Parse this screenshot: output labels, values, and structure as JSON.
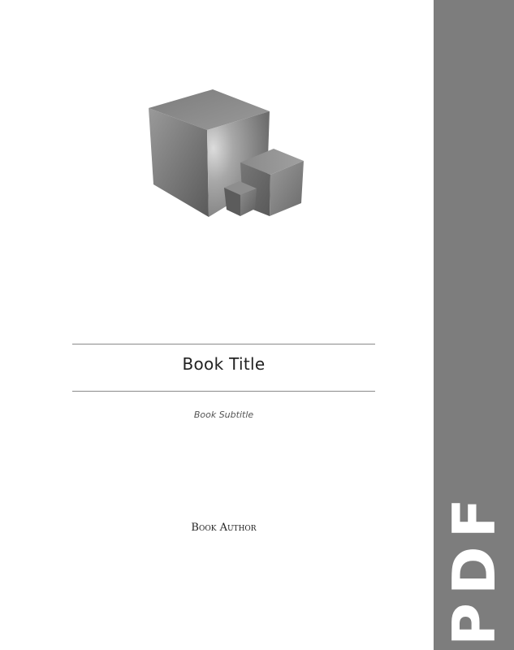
{
  "cover": {
    "title": "Book Title",
    "subtitle": "Book Subtitle",
    "author": "Book Author"
  },
  "side_band": {
    "label": "PDF",
    "color": "#7d7d7d"
  },
  "artwork": {
    "icon": "stacked-cubes-icon"
  }
}
